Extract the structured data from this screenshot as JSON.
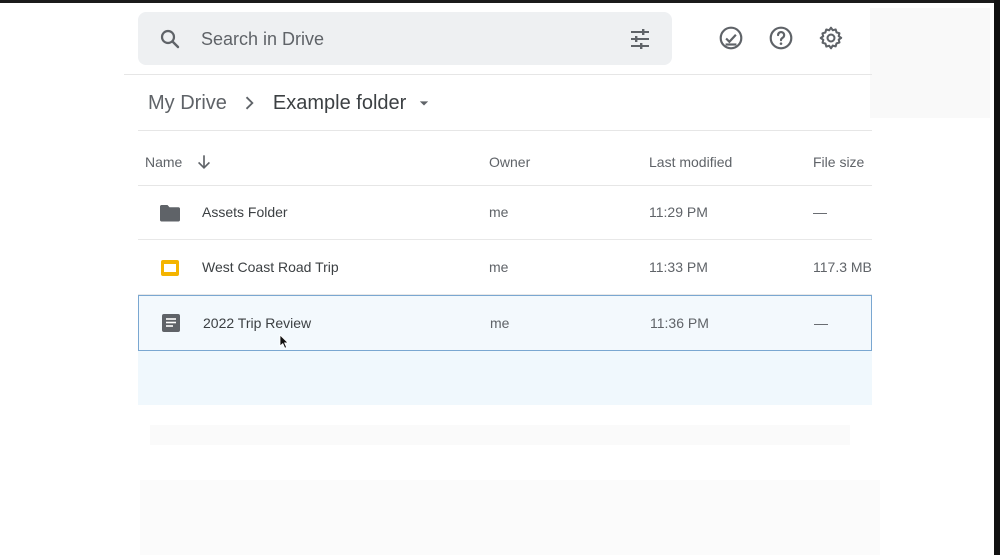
{
  "search": {
    "placeholder": "Search in Drive"
  },
  "toolbar": {
    "icons": [
      "offline-check-icon",
      "help-icon",
      "settings-gear-icon"
    ]
  },
  "breadcrumb": {
    "root": "My Drive",
    "current": "Example folder"
  },
  "table": {
    "columns": {
      "name": "Name",
      "owner": "Owner",
      "last_modified": "Last modified",
      "file_size": "File size"
    },
    "sort": "name-descending",
    "rows": [
      {
        "name": "Assets Folder",
        "type": "folder",
        "owner": "me",
        "last_modified": "11:29 PM",
        "file_size": "—"
      },
      {
        "name": "West Coast Road Trip",
        "type": "slides",
        "owner": "me",
        "last_modified": "11:33 PM",
        "file_size": "117.3 MB"
      },
      {
        "name": "2022 Trip Review",
        "type": "document",
        "owner": "me",
        "last_modified": "11:36 PM",
        "file_size": "—"
      }
    ]
  },
  "colors": {
    "search_bg": "#eef0f2",
    "selected_row_bg": "#f3f9fd",
    "selected_row_border": "#7aa7d1",
    "slides_yellow": "#f4b400",
    "icon_gray": "#5f6368"
  }
}
